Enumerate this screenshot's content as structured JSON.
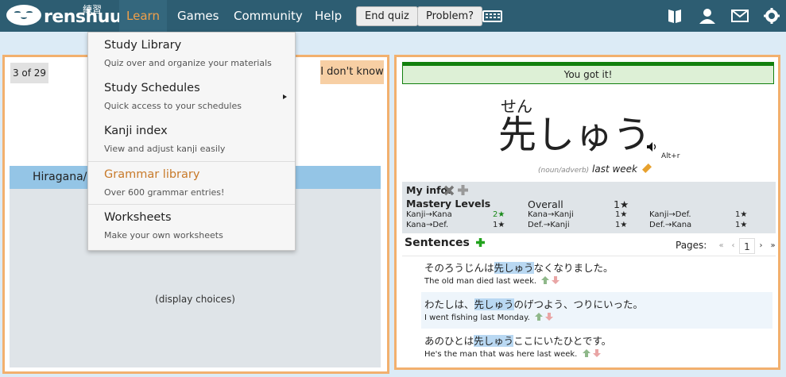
{
  "brand": {
    "name": "renshuu",
    "kanji": "練習"
  },
  "nav": {
    "items": [
      "Learn",
      "Games",
      "Community",
      "Help"
    ],
    "end_quiz": "End quiz",
    "problem": "Problem?"
  },
  "top_icons": [
    "book-icon",
    "user-icon",
    "mail-icon",
    "gear-icon"
  ],
  "dropdown": {
    "items": [
      {
        "title": "Study Library",
        "sub": "Quiz over and organize your materials"
      },
      {
        "title": "Study Schedules",
        "sub": "Quick access to your schedules"
      },
      {
        "title": "Kanji index",
        "sub": "View and adjust kanji easily"
      },
      {
        "title": "Grammar library",
        "sub": "Over 600 grammar entries!"
      },
      {
        "title": "Worksheets",
        "sub": "Make your own worksheets"
      }
    ]
  },
  "quiz": {
    "counter": "3 of 29",
    "idk": "I don't know",
    "hira_label": "Hiragana/k",
    "display_choices": "(display choices)"
  },
  "result": {
    "status": "You got it!",
    "furigana": "せん",
    "word": "先しゅう",
    "shortcut": "Alt+r",
    "pos": "(noun/adverb)",
    "meaning": "last week"
  },
  "my_info": {
    "title": "My info:",
    "mastery_title": "Mastery Levels",
    "overall_label": "Overall",
    "overall_value": "1★",
    "rows": [
      {
        "label": "Kanji→Kana",
        "value": "2★"
      },
      {
        "label": "Kana→Kanji",
        "value": "1★"
      },
      {
        "label": "Kanji→Def.",
        "value": "1★"
      },
      {
        "label": "Kana→Def.",
        "value": "1★"
      },
      {
        "label": "Def.→Kanji",
        "value": "1★"
      },
      {
        "label": "Def.→Kana",
        "value": "1★"
      }
    ]
  },
  "sentences": {
    "title": "Sentences",
    "pages_label": "Pages:",
    "pager": [
      "«",
      "‹",
      "1",
      "›",
      "»"
    ],
    "items": [
      {
        "pre": "そのろうじんは",
        "hl": "先しゅう",
        "post": "なくなりました。",
        "en": "The old man died last week."
      },
      {
        "pre": "わたしは、",
        "hl": "先しゅう",
        "post": "のげつよう、つりにいった。",
        "en": "I went fishing last Monday."
      },
      {
        "pre": "あのひとは",
        "hl": "先しゅう",
        "post": "ここにいたひとです。",
        "en": "He's the man that was here last week."
      }
    ]
  },
  "colors": {
    "nav_bg": "#2d5d72",
    "accent_orange": "#f0a04a",
    "panel_border": "#f2b06e",
    "success_green": "#12800e"
  }
}
